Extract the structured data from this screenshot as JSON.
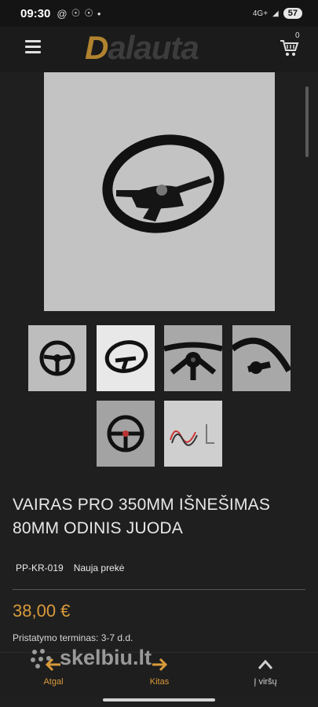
{
  "status": {
    "time": "09:30",
    "network": "4G+",
    "battery": "57"
  },
  "header": {
    "logo_text_a": "D",
    "logo_text_b": "alauta",
    "cart_count": "0"
  },
  "gallery": {
    "main_image": "steering-wheel-black-suede",
    "thumbnails": [
      "steering-wheel-front",
      "steering-wheel-angled",
      "steering-wheel-center-closeup",
      "steering-wheel-rim-closeup",
      "steering-wheel-front-red-stitch",
      "steering-wheel-wiring"
    ],
    "active_index": 1
  },
  "product": {
    "title": "VAIRAS PRO 350MM IŠNEŠIMAS 80MM ODINIS JUODA",
    "sku": "PP-KR-019",
    "condition": "Nauja prekė",
    "price": "38,00 €",
    "delivery": "Pristatymo terminas: 3-7 d.d."
  },
  "bottom_nav": {
    "back_label": "Atgal",
    "next_label": "Kitas",
    "top_label": "Į viršų"
  },
  "watermark": "skelbiu.lt",
  "colors": {
    "accent": "#d99a3a",
    "background": "#1f1f1f"
  }
}
